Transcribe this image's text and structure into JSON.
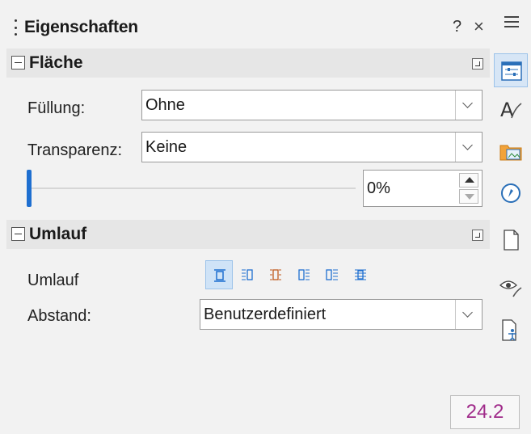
{
  "panel": {
    "title": "Eigenschaften",
    "help_label": "?",
    "close_label": "×"
  },
  "flaeche": {
    "title": "Fläche",
    "fill_label": "Füllung:",
    "fill_value": "Ohne",
    "transparency_label": "Transparenz:",
    "transparency_value": "Keine",
    "slider_percent": 0,
    "spin_value": "0%"
  },
  "umlauf": {
    "title": "Umlauf",
    "wrap_label": "Umlauf",
    "wrap_buttons": [
      "wrap-off",
      "wrap-left",
      "wrap-parallel",
      "wrap-right",
      "wrap-optimal",
      "wrap-through"
    ],
    "active_wrap": "wrap-off",
    "spacing_label": "Abstand:",
    "spacing_value": "Benutzerdefiniert"
  },
  "version_badge": "24.2",
  "deck": {
    "icons": [
      "properties-icon",
      "styles-icon",
      "gallery-icon",
      "navigator-icon",
      "page-icon",
      "style-inspector-icon",
      "accessibility-check-icon"
    ],
    "active": "properties-icon"
  },
  "colors": {
    "accent": "#1e6fd0",
    "version_text": "#a02b8a",
    "active_bg": "#cfe3f7"
  }
}
